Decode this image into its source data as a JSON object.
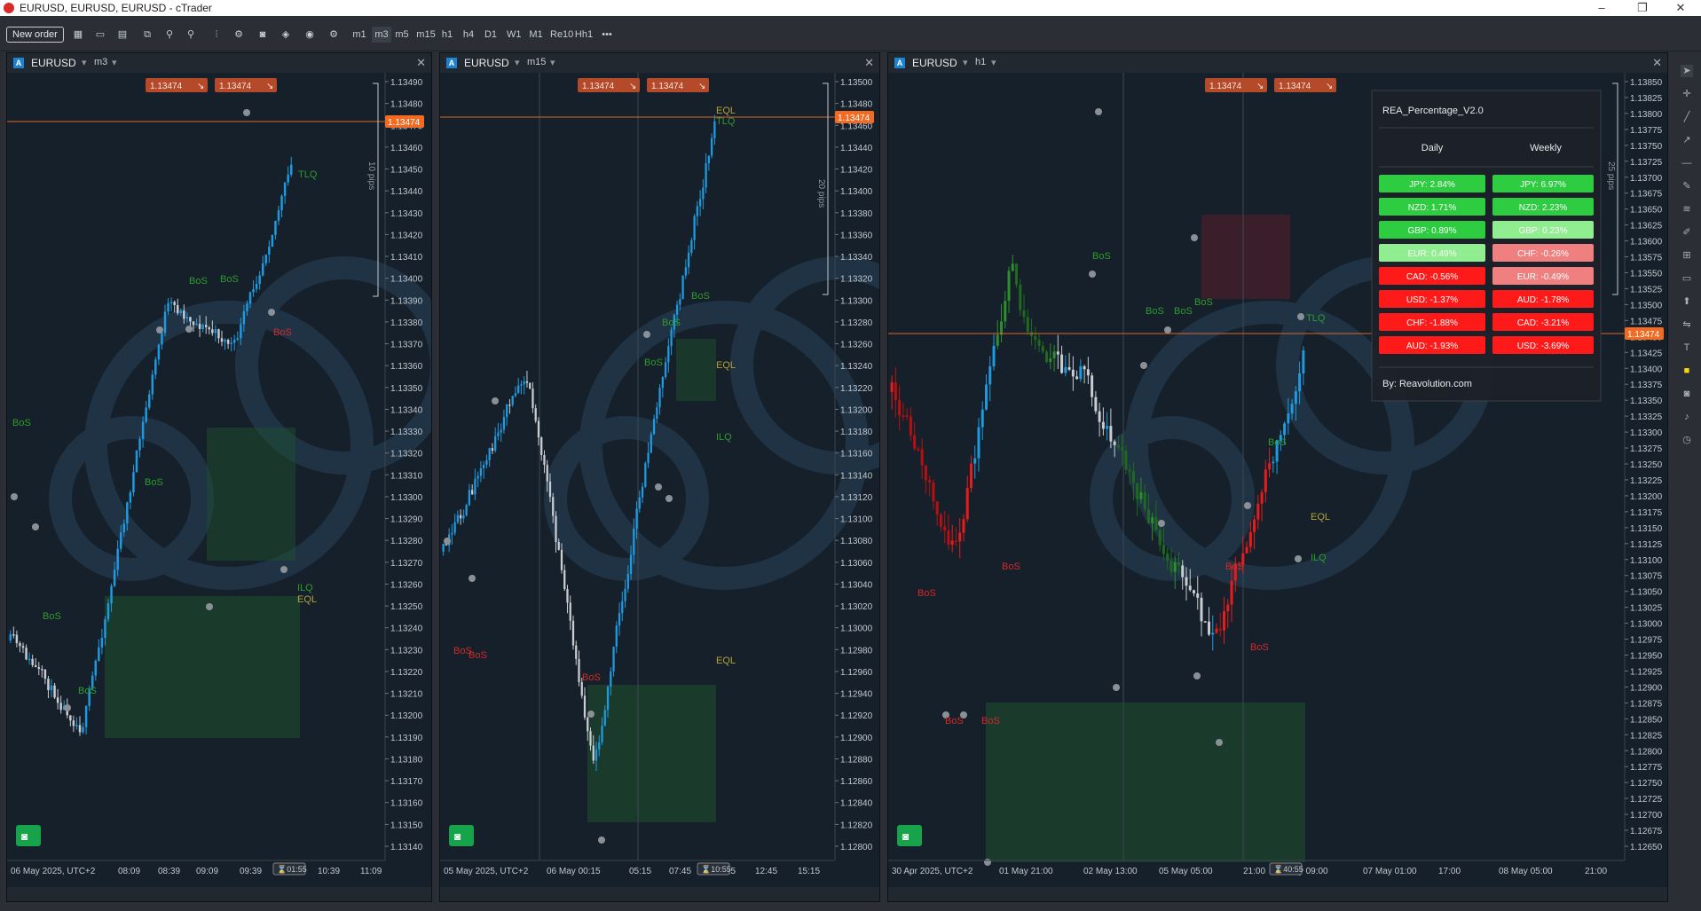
{
  "window": {
    "title": "EURUSD, EURUSD, EURUSD - cTrader"
  },
  "toolbar": {
    "new_order": "New order",
    "timeframes": [
      "m1",
      "m3",
      "m5",
      "m15",
      "h1",
      "h4",
      "D1",
      "W1",
      "M1",
      "Re10",
      "Hh1"
    ],
    "more": "•••"
  },
  "charts": [
    {
      "symbol": "EURUSD",
      "timeframe": "m3",
      "price_buttons": [
        "1.13474",
        "1.13474"
      ],
      "current_price": "1.13474",
      "ruler_label": "10 pips",
      "date_label": "06 May 2025, UTC+2",
      "time_labels": [
        "08:09",
        "08:39",
        "09:09",
        "09:39",
        "10:09",
        "10:39",
        "11:09"
      ],
      "countdown": "01:55",
      "price_axis": [
        "1.13490",
        "1.13480",
        "1.13470",
        "1.13460",
        "1.13450",
        "1.13440",
        "1.13430",
        "1.13420",
        "1.13410",
        "1.13400",
        "1.13390",
        "1.13380",
        "1.13370",
        "1.13360",
        "1.13350",
        "1.13340",
        "1.13330",
        "1.13320",
        "1.13310",
        "1.13300",
        "1.13290",
        "1.13280",
        "1.13270",
        "1.13260",
        "1.13250",
        "1.13240",
        "1.13230",
        "1.13220",
        "1.13210",
        "1.13200",
        "1.13190",
        "1.13180",
        "1.13170",
        "1.13160",
        "1.13150",
        "1.13140"
      ],
      "annotations": [
        "TLQ",
        "BoS",
        "BoS",
        "BoS",
        "BoS",
        "BoS",
        "BoS",
        "BoS",
        "ILQ",
        "EQL"
      ]
    },
    {
      "symbol": "EURUSD",
      "timeframe": "m15",
      "price_buttons": [
        "1.13474",
        "1.13474"
      ],
      "current_price": "1.13474",
      "ruler_label": "20 pips",
      "date_label": "05 May 2025, UTC+2",
      "time_labels": [
        "06 May 00:15",
        "05:15",
        "07:45",
        "10:15",
        "12:45",
        "15:15"
      ],
      "countdown": "10:55",
      "price_axis": [
        "1.13500",
        "1.13480",
        "1.13460",
        "1.13440",
        "1.13420",
        "1.13400",
        "1.13380",
        "1.13360",
        "1.13340",
        "1.13320",
        "1.13300",
        "1.13280",
        "1.13260",
        "1.13240",
        "1.13220",
        "1.13200",
        "1.13180",
        "1.13160",
        "1.13140",
        "1.13120",
        "1.13100",
        "1.13080",
        "1.13060",
        "1.13040",
        "1.13020",
        "1.13000",
        "1.12980",
        "1.12960",
        "1.12940",
        "1.12920",
        "1.12900",
        "1.12880",
        "1.12860",
        "1.12840",
        "1.12820",
        "1.12800"
      ],
      "annotations": [
        "EQL",
        "TLQ",
        "BoS",
        "BoS",
        "BoS",
        "EQL",
        "ILQ",
        "BoS",
        "BoS",
        "BoS",
        "EQL"
      ]
    },
    {
      "symbol": "EURUSD",
      "timeframe": "h1",
      "price_buttons": [
        "1.13474",
        "1.13474"
      ],
      "current_price": "1.13474",
      "ruler_label": "25 pips",
      "date_label": "30 Apr 2025, UTC+2",
      "time_labels": [
        "01 May 21:00",
        "02 May 13:00",
        "05 May 05:00",
        "21:00",
        "06 May 09:00",
        "07 May 01:00",
        "17:00",
        "08 May 05:00",
        "21:00"
      ],
      "countdown": "40:55",
      "price_axis": [
        "1.13850",
        "1.13825",
        "1.13800",
        "1.13775",
        "1.13750",
        "1.13725",
        "1.13700",
        "1.13675",
        "1.13650",
        "1.13625",
        "1.13600",
        "1.13575",
        "1.13550",
        "1.13525",
        "1.13500",
        "1.13475",
        "1.13450",
        "1.13425",
        "1.13400",
        "1.13375",
        "1.13350",
        "1.13325",
        "1.13300",
        "1.13275",
        "1.13250",
        "1.13225",
        "1.13200",
        "1.13175",
        "1.13150",
        "1.13125",
        "1.13100",
        "1.13075",
        "1.13050",
        "1.13025",
        "1.13000",
        "1.12975",
        "1.12950",
        "1.12925",
        "1.12900",
        "1.12875",
        "1.12850",
        "1.12825",
        "1.12800",
        "1.12775",
        "1.12750",
        "1.12725",
        "1.12700",
        "1.12675",
        "1.12650"
      ],
      "annotations": [
        "BoS",
        "BoS",
        "BoS",
        "BoS",
        "BoS",
        "BoS",
        "BoS",
        "BoS",
        "BoS",
        "BoS",
        "TLQ",
        "EQL",
        "ILQ",
        "BoS"
      ]
    }
  ],
  "indicator": {
    "title": "REA_Percentage_V2.0",
    "col_daily": "Daily",
    "col_weekly": "Weekly",
    "daily": [
      {
        "text": "JPY: 2.84%",
        "color": "#2ecc40"
      },
      {
        "text": "NZD: 1.71%",
        "color": "#2ecc40"
      },
      {
        "text": "GBP: 0.89%",
        "color": "#2ecc40"
      },
      {
        "text": "EUR: 0.49%",
        "color": "#90ee90"
      },
      {
        "text": "CAD: -0.56%",
        "color": "#ff1a1a"
      },
      {
        "text": "USD: -1.37%",
        "color": "#ff1a1a"
      },
      {
        "text": "CHF: -1.88%",
        "color": "#ff1a1a"
      },
      {
        "text": "AUD: -1.93%",
        "color": "#ff1a1a"
      }
    ],
    "weekly": [
      {
        "text": "JPY: 6.97%",
        "color": "#2ecc40"
      },
      {
        "text": "NZD: 2.23%",
        "color": "#2ecc40"
      },
      {
        "text": "GBP: 0.23%",
        "color": "#90ee90"
      },
      {
        "text": "CHF: -0.26%",
        "color": "#f08080"
      },
      {
        "text": "EUR: -0.49%",
        "color": "#f08080"
      },
      {
        "text": "AUD: -1.78%",
        "color": "#ff1a1a"
      },
      {
        "text": "CAD: -3.21%",
        "color": "#ff1a1a"
      },
      {
        "text": "USD: -3.69%",
        "color": "#ff1a1a"
      }
    ],
    "footer": "By: Reavolution.com"
  }
}
